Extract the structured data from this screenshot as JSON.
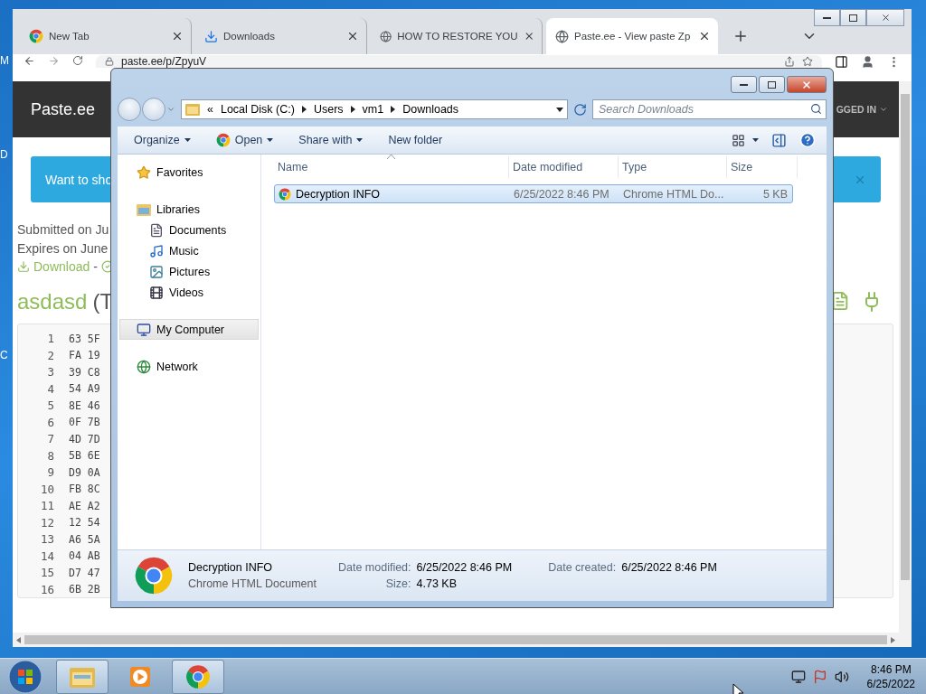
{
  "desktop": {
    "edge_labels": [
      "M",
      "D",
      "C"
    ]
  },
  "browser": {
    "tabs": [
      {
        "title": "New Tab",
        "kind": "chrome",
        "selected": false
      },
      {
        "title": "Downloads",
        "kind": "download",
        "selected": false
      },
      {
        "title": "HOW TO RESTORE YOU",
        "kind": "globe",
        "selected": false
      },
      {
        "title": "Paste.ee - View paste Zp",
        "kind": "globe",
        "selected": true
      }
    ],
    "address": "paste.ee/p/ZpyuV",
    "page": {
      "brand": "Paste.ee",
      "account": "GGED IN",
      "alert": "Want to sho",
      "meta": [
        "Submitted on Ju",
        "Expires on June"
      ],
      "download_link": "Download",
      "separator": "-",
      "title": "asdasd",
      "title_suffix": "(T",
      "lines": [
        {
          "number": "1",
          "code": "63 5F"
        },
        {
          "number": "2",
          "code": "FA 19"
        },
        {
          "number": "3",
          "code": "39 C8"
        },
        {
          "number": "4",
          "code": "54 A9"
        },
        {
          "number": "5",
          "code": "8E 46"
        },
        {
          "number": "6",
          "code": "0F 7B"
        },
        {
          "number": "7",
          "code": "4D 7D"
        },
        {
          "number": "8",
          "code": "5B 6E"
        },
        {
          "number": "9",
          "code": "D9 0A"
        },
        {
          "number": "10",
          "code": "FB 8C"
        },
        {
          "number": "11",
          "code": "AE A2"
        },
        {
          "number": "12",
          "code": "12 54"
        },
        {
          "number": "13",
          "code": "A6 5A"
        },
        {
          "number": "14",
          "code": "04 AB"
        },
        {
          "number": "15",
          "code": "D7 47"
        },
        {
          "number": "16",
          "code": "6B 2B"
        }
      ]
    }
  },
  "explorer": {
    "prefix": "«",
    "path": [
      "Local Disk (C:)",
      "Users",
      "vm1",
      "Downloads"
    ],
    "search": {
      "placeholder": "Search Downloads"
    },
    "toolbar": [
      {
        "label": "Organize",
        "dropdown": true
      },
      {
        "label": "Open",
        "kind": "chrome",
        "dropdown": true
      },
      {
        "label": "Share with",
        "dropdown": true
      },
      {
        "label": "New folder",
        "dropdown": false
      }
    ],
    "nav": [
      {
        "label": "Favorites",
        "kind": "star",
        "selected": false
      },
      {
        "label": "Libraries",
        "kind": "library",
        "selected": false,
        "children": [
          {
            "label": "Documents",
            "kind": "document",
            "selected": false
          },
          {
            "label": "Music",
            "kind": "music",
            "selected": false
          },
          {
            "label": "Pictures",
            "kind": "pictures",
            "selected": false
          },
          {
            "label": "Videos",
            "kind": "videos",
            "selected": false
          }
        ]
      },
      {
        "label": "My Computer",
        "kind": "computer",
        "selected": true
      },
      {
        "label": "Network",
        "kind": "network",
        "selected": false
      }
    ],
    "columns": [
      {
        "label": "Name",
        "sorted": true
      },
      {
        "label": "Date modified",
        "sorted": false
      },
      {
        "label": "Type",
        "sorted": false
      },
      {
        "label": "Size",
        "sorted": false
      }
    ],
    "rows": [
      {
        "name": "Decryption INFO",
        "date": "6/25/2022 8:46 PM",
        "type": "Chrome HTML Do...",
        "size": "5 KB",
        "selected": true
      }
    ],
    "details": {
      "name": "Decryption INFO",
      "type": "Chrome HTML Document",
      "fields": [
        {
          "label": "Date modified:",
          "value": "6/25/2022 8:46 PM"
        },
        {
          "label": "Date created:",
          "value": "6/25/2022 8:46 PM"
        },
        {
          "label": "Size:",
          "value": "4.73 KB"
        }
      ]
    }
  },
  "taskbar": {
    "apps": [
      {
        "kind": "explorer",
        "running": true
      },
      {
        "kind": "media",
        "running": false
      },
      {
        "kind": "chrome",
        "running": true
      }
    ],
    "time": "8:46 PM",
    "date": "6/25/2022"
  }
}
